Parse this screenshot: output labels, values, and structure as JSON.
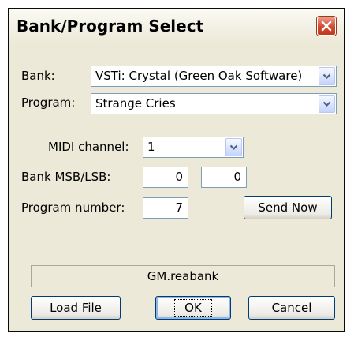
{
  "dialog": {
    "title": "Bank/Program Select",
    "close_icon": "close-icon"
  },
  "bank": {
    "label": "Bank:",
    "value": "VSTi: Crystal (Green Oak Software)"
  },
  "program": {
    "label": "Program:",
    "value": "Strange Cries"
  },
  "midi_channel": {
    "label": "MIDI channel:",
    "value": "1"
  },
  "bank_msb_lsb": {
    "label": "Bank MSB/LSB:",
    "msb": "0",
    "lsb": "0"
  },
  "program_number": {
    "label": "Program number:",
    "value": "7"
  },
  "buttons": {
    "send_now": "Send Now",
    "load_file": "Load File",
    "ok": "OK",
    "cancel": "Cancel"
  },
  "status": {
    "file": "GM.reabank"
  },
  "colors": {
    "dialog_bg": "#ece9d8",
    "close_button": "#d14a2c",
    "field_border": "#7f9db9",
    "button_border": "#003c74"
  }
}
